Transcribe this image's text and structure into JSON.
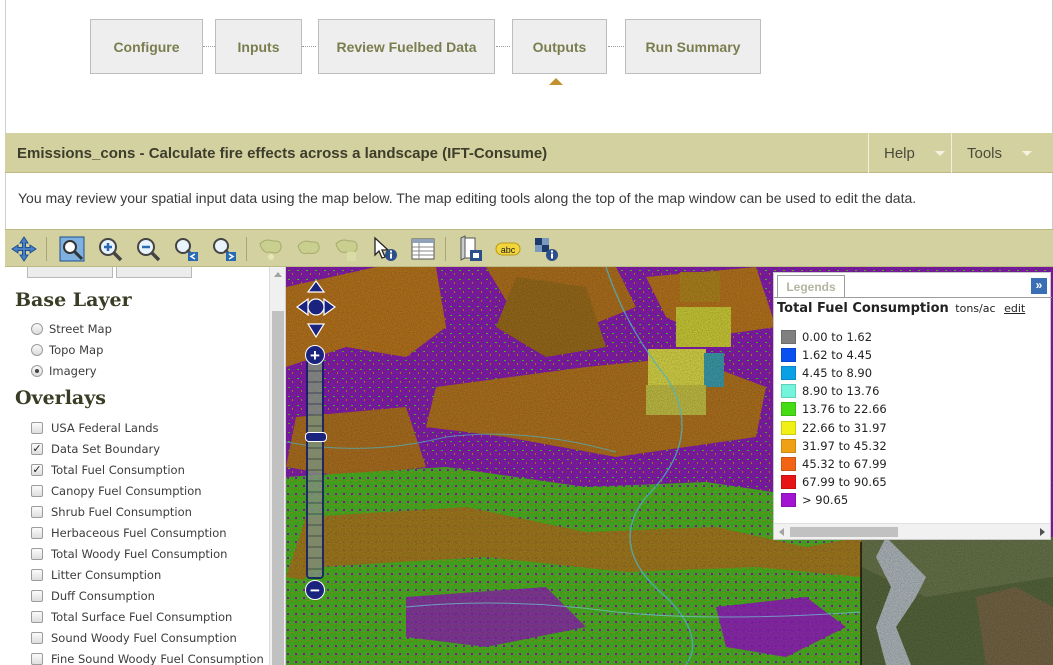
{
  "steps": [
    {
      "label": "Configure"
    },
    {
      "label": "Inputs"
    },
    {
      "label": "Review Fuelbed Data"
    },
    {
      "label": "Outputs"
    },
    {
      "label": "Run Summary"
    }
  ],
  "active_step": "Outputs",
  "header": {
    "title": "Emissions_cons - Calculate fire effects across a landscape (IFT-Consume)",
    "help_label": "Help",
    "tools_label": "Tools"
  },
  "intro_text": "You may review your spatial input data using the map below. The map editing tools along the top of the map window can be used to edit the data.",
  "toolbar": {
    "tools": [
      "pan-icon",
      "zoom-extent-icon",
      "zoom-in-icon",
      "zoom-out-icon",
      "zoom-previous-icon",
      "zoom-next-icon",
      "select-polygon-icon",
      "edit-polygon-icon",
      "polygon-info-icon",
      "identify-icon",
      "attribute-table-icon",
      "export-map-icon",
      "label-icon",
      "layer-info-icon"
    ]
  },
  "layers": {
    "base_title": "Base Layer",
    "base_layers": [
      {
        "label": "Street Map",
        "selected": false
      },
      {
        "label": "Topo Map",
        "selected": false
      },
      {
        "label": "Imagery",
        "selected": true
      }
    ],
    "overlays_title": "Overlays",
    "overlays": [
      {
        "label": "USA Federal Lands",
        "checked": false
      },
      {
        "label": "Data Set Boundary",
        "checked": true
      },
      {
        "label": "Total Fuel Consumption",
        "checked": true
      },
      {
        "label": "Canopy Fuel Consumption",
        "checked": false
      },
      {
        "label": "Shrub Fuel Consumption",
        "checked": false
      },
      {
        "label": "Herbaceous Fuel Consumption",
        "checked": false
      },
      {
        "label": "Total Woody Fuel Consumption",
        "checked": false
      },
      {
        "label": "Litter Consumption",
        "checked": false
      },
      {
        "label": "Duff Consumption",
        "checked": false
      },
      {
        "label": "Total Surface Fuel Consumption",
        "checked": false
      },
      {
        "label": "Sound Woody Fuel Consumption",
        "checked": false
      },
      {
        "label": "Fine Sound Woody Fuel Consumption",
        "checked": false
      }
    ]
  },
  "legend": {
    "tab_label": "Legends",
    "expand_label": "»",
    "title": "Total Fuel Consumption",
    "units": "tons/ac",
    "edit_label": "edit",
    "classes": [
      {
        "label": "0.00 to 1.62",
        "color": "#808080"
      },
      {
        "label": "1.62 to 4.45",
        "color": "#0a50f0"
      },
      {
        "label": "4.45 to 8.90",
        "color": "#0aa0e6"
      },
      {
        "label": "8.90 to 13.76",
        "color": "#73f5dc"
      },
      {
        "label": "13.76 to 22.66",
        "color": "#46dc14"
      },
      {
        "label": "22.66 to 31.97",
        "color": "#f0f014"
      },
      {
        "label": "31.97 to 45.32",
        "color": "#f0a014"
      },
      {
        "label": "45.32 to 67.99",
        "color": "#f06414"
      },
      {
        "label": "67.99 to 90.65",
        "color": "#e61414"
      },
      {
        "label": "> 90.65",
        "color": "#a014d2"
      }
    ]
  },
  "map_controls": {
    "zoom_in_label": "+",
    "zoom_out_label": "−"
  }
}
